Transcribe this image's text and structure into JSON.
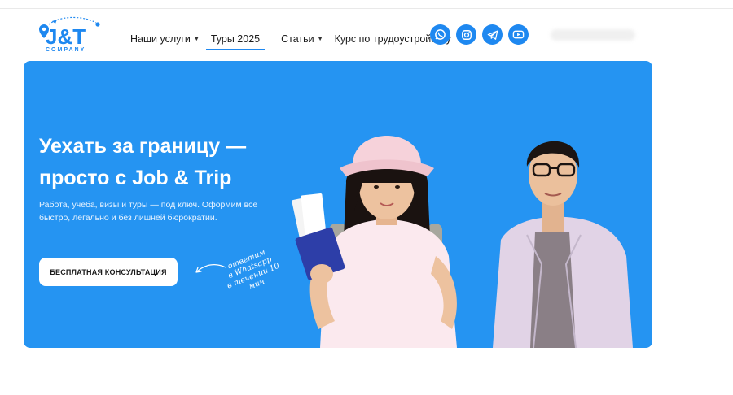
{
  "brand": {
    "logo_text": "J&T",
    "logo_sub": "COMPANY",
    "color": "#1e88f0"
  },
  "nav": {
    "items": [
      {
        "label": "Наши услуги",
        "dropdown": true
      },
      {
        "label": "Туры 2025",
        "dropdown": false,
        "active": true
      },
      {
        "label": "Статьи",
        "dropdown": true
      },
      {
        "label": "Курс по трудоустройству",
        "dropdown": false
      }
    ]
  },
  "socials": [
    "whatsapp-icon",
    "instagram-icon",
    "telegram-icon",
    "youtube-icon"
  ],
  "hero": {
    "title_line1": "Уехать за границу —",
    "title_line2": "просто с Job & Trip",
    "subtitle": "Работа, учёба, визы и туры — под ключ. Оформим всё быстро, легально и без лишней бюрократии.",
    "cta_label": "БЕСПЛАТНАЯ КОНСУЛЬТАЦИЯ",
    "note_line1": "ответим",
    "note_line2": "в Whatsapp",
    "note_line3": "в течении 10 мин",
    "bg_color": "#2594f2"
  }
}
